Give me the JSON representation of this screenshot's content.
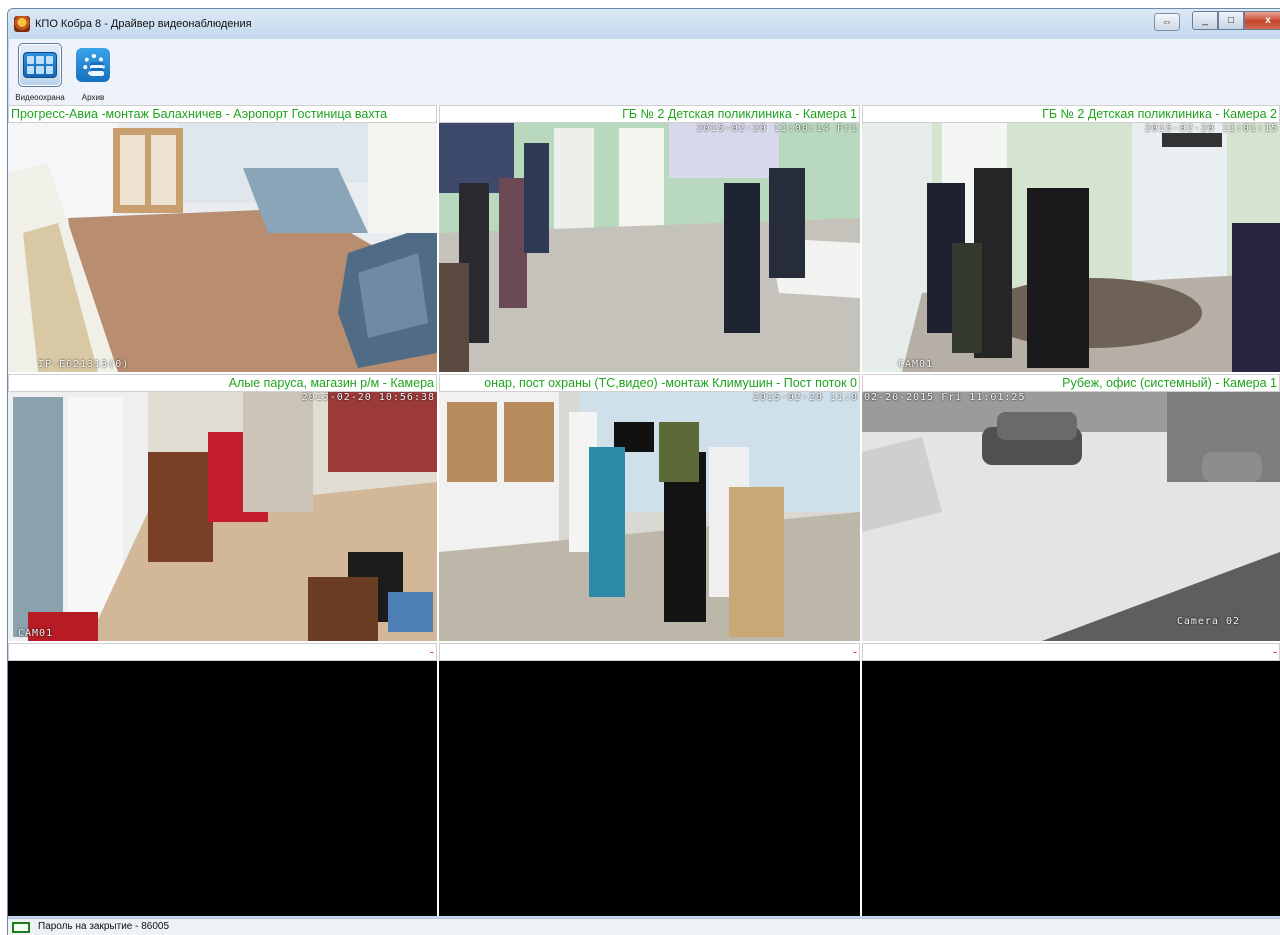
{
  "window": {
    "title": "КПО Кобра 8 - Драйвер видеонаблюдения",
    "close_glyph": "x",
    "min_glyph": "_",
    "max_glyph": "□",
    "restore_glyph": "⇔"
  },
  "toolbar": {
    "items": [
      {
        "label": "Видеоохрана",
        "icon": "video-grid-icon",
        "active": true
      },
      {
        "label": "Архив",
        "icon": "archive-gear-icon",
        "active": false
      }
    ]
  },
  "cameras": [
    {
      "title": "Прогресс-Авиа -монтаж Балахничев - Аэропорт Гостиница вахта",
      "osd": "IP-E021313(0)",
      "scene": "hall"
    },
    {
      "title": "ГБ № 2 Детская поликлиника - Камера 1",
      "osd": "2015-02-20 11:00:14 Fri",
      "scene": "clinic"
    },
    {
      "title": "ГБ № 2 Детская поликлиника - Камера 2",
      "osd": "2015-02-20 11:01:15",
      "osd2": "CAM01",
      "scene": "clinic2"
    },
    {
      "title": "Алые паруса, магазин р/м - Камера",
      "osd": "2015-02-20 10:56:38",
      "osd2": "CAM01",
      "scene": "shop"
    },
    {
      "title": "онар, пост охраны (ТС,видео) -монтаж Климушин - Пост поток 0",
      "osd": "2015-02-20 11:0",
      "scene": "post"
    },
    {
      "title": "Рубеж, офис (системный) - Камера 1",
      "osd": "02-20-2015 Fri 11:01:25",
      "osd2": "Camera 02",
      "scene": "snow"
    },
    {
      "title": "-",
      "scene": "none"
    },
    {
      "title": "-",
      "scene": "none"
    },
    {
      "title": "-",
      "scene": "none"
    }
  ],
  "status": {
    "text": "Пароль на закрытие - 86005"
  }
}
